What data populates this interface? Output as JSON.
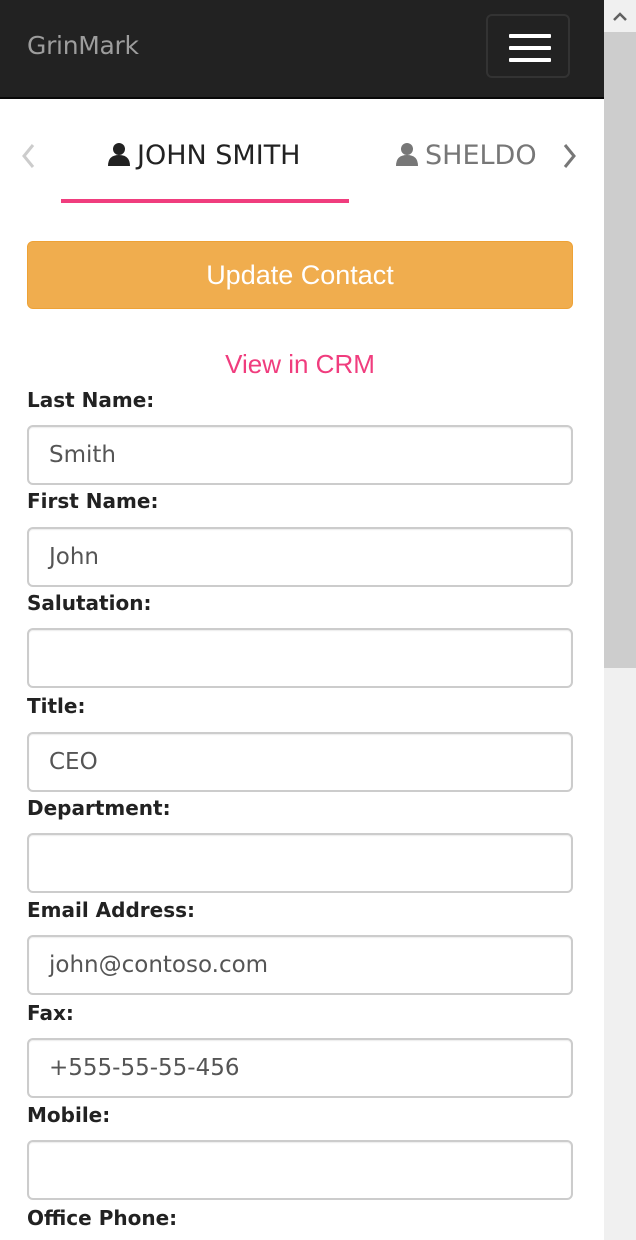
{
  "navbar": {
    "brand": "GrinMark",
    "menu_icon": "hamburger-menu-icon"
  },
  "contact_tabs": {
    "prev_icon": "chevron-left-icon",
    "next_icon": "chevron-right-icon",
    "items": [
      {
        "label": "JOHN SMITH",
        "icon": "user-icon",
        "active": true
      },
      {
        "label": "SHELDON",
        "icon": "user-icon",
        "active": false
      }
    ],
    "accent_color": "#f03d7e"
  },
  "actions": {
    "update_label": "Update Contact",
    "update_color": "#f0ad4e",
    "crm_link": "View in CRM"
  },
  "form": {
    "fields": [
      {
        "label": "Last Name:",
        "value": "Smith"
      },
      {
        "label": "First Name:",
        "value": "John"
      },
      {
        "label": "Salutation:",
        "value": ""
      },
      {
        "label": "Title:",
        "value": "CEO"
      },
      {
        "label": "Department:",
        "value": ""
      },
      {
        "label": "Email Address:",
        "value": "john@contoso.com"
      },
      {
        "label": "Fax:",
        "value": "+555-55-55-456"
      },
      {
        "label": "Mobile:",
        "value": ""
      },
      {
        "label": "Office Phone:",
        "value": ""
      }
    ]
  },
  "scrollbar": {
    "up_icon": "scroll-up-arrow-icon",
    "position_fraction": 0.0
  }
}
